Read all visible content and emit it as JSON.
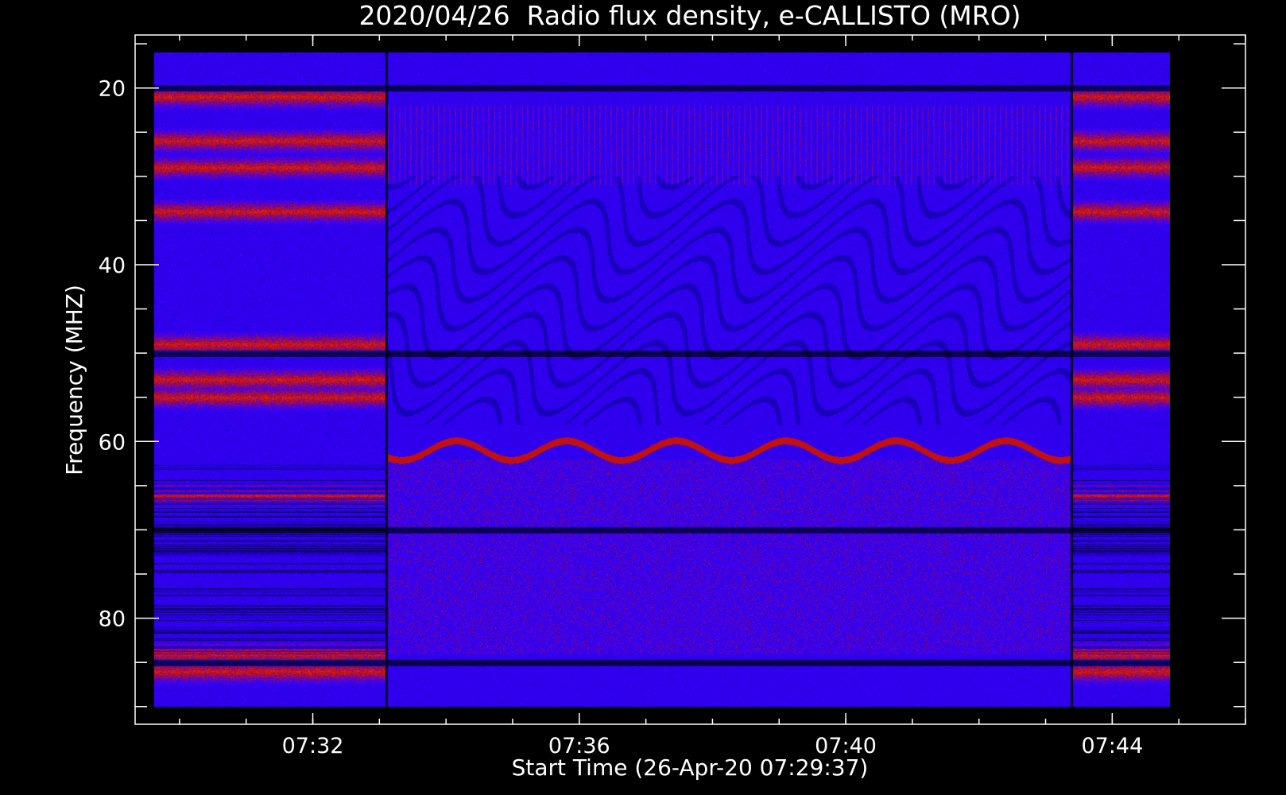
{
  "chart_data": {
    "type": "heatmap",
    "title": "2020/04/26  Radio flux density, e-CALLISTO (MRO)",
    "xlabel": "Start Time (26-Apr-20 07:29:37)",
    "ylabel": "Frequency (MHZ)",
    "x_unit": "UT time (HH:MM)",
    "x_range": [
      "07:29:37",
      "07:44:52"
    ],
    "xlim": [
      "07:29:20",
      "07:46:00"
    ],
    "ylim": [
      14,
      92
    ],
    "y_inverted": true,
    "data_freq_range_mhz": [
      16,
      90
    ],
    "x_major_ticks": [
      "07:32",
      "07:36",
      "07:40",
      "07:44"
    ],
    "y_major_ticks": [
      20,
      40,
      60,
      80
    ],
    "colormap": [
      "#000000",
      "#1a00c8",
      "#3a00ff",
      "#c01010",
      "#ff3000",
      "#ffa020"
    ],
    "segments": [
      {
        "start": "07:29:37",
        "end": "07:33:05",
        "level": "high"
      },
      {
        "start": "07:33:05",
        "end": "07:43:22",
        "level": "low"
      },
      {
        "start": "07:43:22",
        "end": "07:44:52",
        "level": "high"
      }
    ],
    "bright_bands_mhz": [
      21,
      26,
      29,
      34,
      49,
      53,
      55,
      66,
      84,
      86
    ],
    "dark_lines_mhz": [
      20,
      50,
      70,
      85
    ],
    "wavy_trace_mhz": 61
  }
}
